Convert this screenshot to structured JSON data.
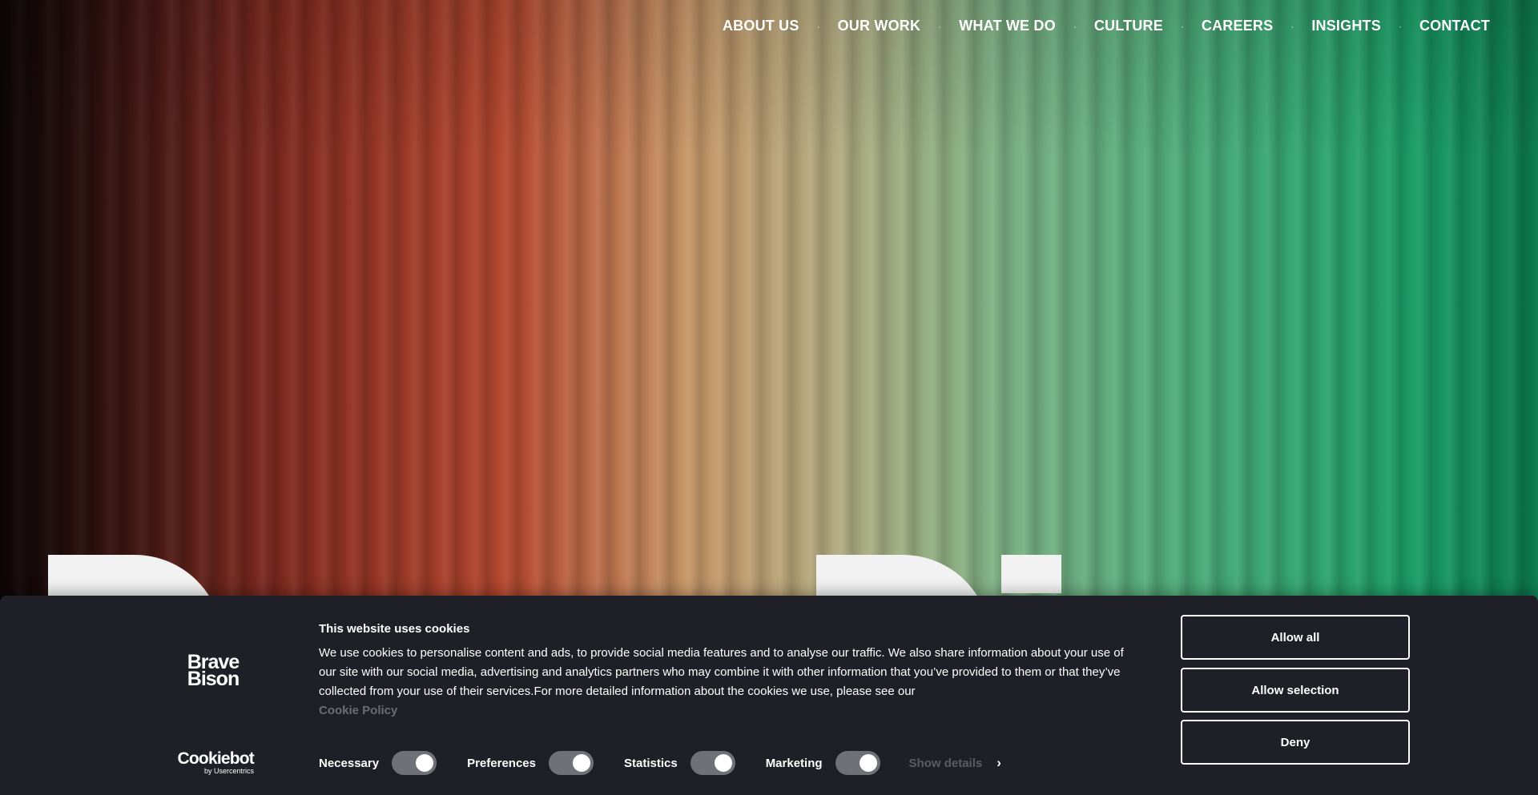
{
  "nav": {
    "items": [
      "ABOUT US",
      "OUR WORK",
      "WHAT WE DO",
      "CULTURE",
      "CAREERS",
      "INSIGHTS",
      "CONTACT"
    ],
    "separator": "·"
  },
  "cookie": {
    "title": "This website uses cookies",
    "text": "We use cookies to personalise content and ads, to provide social media features and to analyse our traffic. We also share information about your use of our site with our social media, advertising and analytics partners who may combine it with other information that you’ve provided to them or that they’ve collected from your use of their services.For more detailed information about the cookies we use, please see our",
    "policy_link": "Cookie Policy",
    "brand_logo": "Brave Bison",
    "cookiebot_logo": "Cookiebot",
    "cookiebot_sub": "by Usercentrics",
    "toggles": [
      {
        "label": "Necessary",
        "checked": true
      },
      {
        "label": "Preferences",
        "checked": true
      },
      {
        "label": "Statistics",
        "checked": true
      },
      {
        "label": "Marketing",
        "checked": true
      }
    ],
    "show_details": "Show details",
    "buttons": {
      "allow_all": "Allow all",
      "allow_selection": "Allow selection",
      "deny": "Deny"
    }
  },
  "colors": {
    "panel_bg": "#1e1f27",
    "toggle_bg": "#6f7078",
    "gradient_start": "#1a0b0e",
    "gradient_end": "#0c7a4f"
  }
}
